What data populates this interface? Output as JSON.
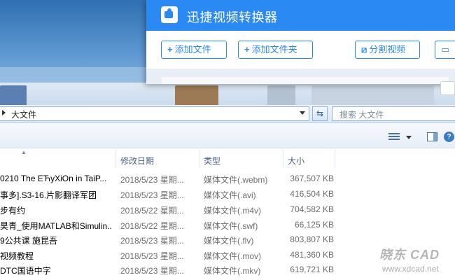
{
  "converter": {
    "title": "迅捷视频转换器",
    "buttons": {
      "add_file": "添加文件",
      "add_folder": "添加文件夹",
      "split_video": "分割视频"
    },
    "colors": {
      "accent": "#2b89f3"
    }
  },
  "explorer": {
    "address": "大文件",
    "search_placeholder": "搜索 大文件",
    "columns": {
      "date": "修改日期",
      "type": "类型",
      "size": "大小"
    },
    "files": [
      {
        "name": "0210 The EЋyXiOn in TaiP...",
        "date": "2018/5/23 星期...",
        "type": "媒体文件(.webm)",
        "size": "367,507 KB"
      },
      {
        "name": "事多].S3-16.片影翻译军团",
        "date": "2018/5/23 星期...",
        "type": "媒体文件(.avi)",
        "size": "416,504 KB"
      },
      {
        "name": "步有约",
        "date": "2018/5/22 星期...",
        "type": "媒体文件(.m4v)",
        "size": "704,582 KB"
      },
      {
        "name": "昊青_使用MATLAB和Simulin...",
        "date": "2018/5/22 星期...",
        "type": "媒体文件(.swf)",
        "size": "66,125 KB"
      },
      {
        "name": "9公共课 施昆吾",
        "date": "2018/5/23 星期...",
        "type": "媒体文件(.flv)",
        "size": "803,807 KB"
      },
      {
        "name": "视频教程",
        "date": "2018/5/23 星期...",
        "type": "媒体文件(.mov)",
        "size": "481,360 KB"
      },
      {
        "name": "DTC国语中字",
        "date": "2018/5/23 星期...",
        "type": "媒体文件(.mkv)",
        "size": "619,721 KB"
      }
    ]
  },
  "watermark": {
    "text": "晓东 CAD",
    "url": "www.xdcad.net"
  }
}
